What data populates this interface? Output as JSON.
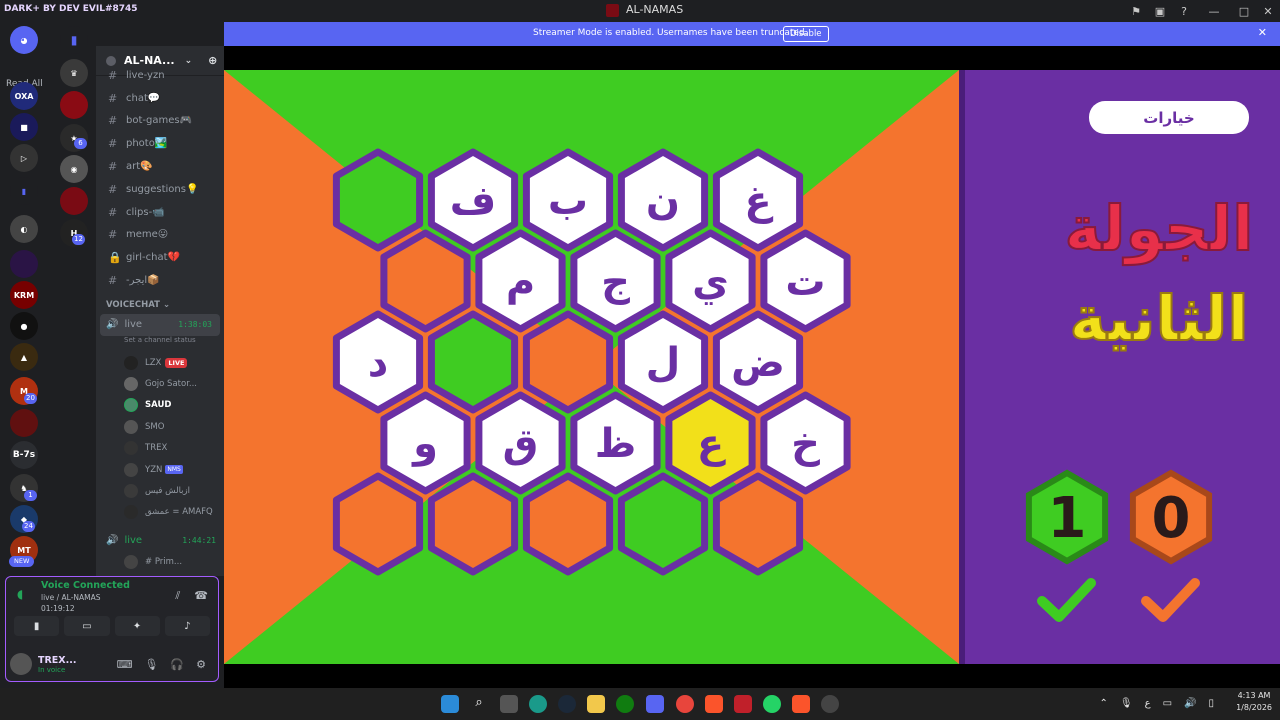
{
  "window": {
    "brand": "DARK+ BY DEV EVIL#8745",
    "title": "AL-NAMAS"
  },
  "servers": {
    "read_all": "Read All",
    "badges": [
      "6",
      "12",
      "20",
      "1",
      "24"
    ],
    "new": "NEW",
    "b7s": "B-7s"
  },
  "guild": {
    "name": "AL-NA..."
  },
  "channels": [
    {
      "name": "live-yzn"
    },
    {
      "name": "chat💬"
    },
    {
      "name": "bot-games🎮"
    },
    {
      "name": "photo🏞️"
    },
    {
      "name": "art🎨"
    },
    {
      "name": "suggestions💡"
    },
    {
      "name": "clips-📹"
    },
    {
      "name": "meme😛"
    },
    {
      "name": "girl-chat💔"
    },
    {
      "name": "-ايجر📦"
    }
  ],
  "voice_category": "VOICECHAT",
  "voice_channels": [
    {
      "name": "live",
      "timer": "1:38:03",
      "status_hint": "Set a channel status"
    },
    {
      "name": "live",
      "timer": "1:44:21"
    }
  ],
  "voice_users": [
    {
      "name": "LZX",
      "tag": "LIVE"
    },
    {
      "name": "Gojo Sator..."
    },
    {
      "name": "SAUD"
    },
    {
      "name": "SMO"
    },
    {
      "name": "TREX"
    },
    {
      "name": "YZN",
      "tag": "NMS"
    },
    {
      "name": "ازبالش فيس"
    },
    {
      "name": "عمشق = AMAFQ"
    }
  ],
  "second_vc_user": "# Prim...",
  "voice_panel": {
    "title": "Voice Connected",
    "channel": "live / AL-NAMAS",
    "time": "01:19:12"
  },
  "user_panel": {
    "name": "TREX...",
    "status": "In voice"
  },
  "banner": {
    "message": "Streamer Mode is enabled. Usernames have been truncated.",
    "button": "Disable"
  },
  "game": {
    "options_button": "خيارات",
    "round_line1": "الجولة",
    "round_line2": "الثانية",
    "score_green": "1",
    "score_orange": "0",
    "cells": [
      {
        "letter": "",
        "color": "green"
      },
      {
        "letter": "ف",
        "color": "white"
      },
      {
        "letter": "ب",
        "color": "white"
      },
      {
        "letter": "ن",
        "color": "white"
      },
      {
        "letter": "غ",
        "color": "white"
      },
      {
        "letter": "",
        "color": "orange"
      },
      {
        "letter": "م",
        "color": "white"
      },
      {
        "letter": "ج",
        "color": "white"
      },
      {
        "letter": "ي",
        "color": "white"
      },
      {
        "letter": "ت",
        "color": "white"
      },
      {
        "letter": "د",
        "color": "white"
      },
      {
        "letter": "",
        "color": "green"
      },
      {
        "letter": "",
        "color": "orange"
      },
      {
        "letter": "ل",
        "color": "white"
      },
      {
        "letter": "ض",
        "color": "white"
      },
      {
        "letter": "و",
        "color": "white"
      },
      {
        "letter": "ق",
        "color": "white"
      },
      {
        "letter": "ظ",
        "color": "white"
      },
      {
        "letter": "ع",
        "color": "yellow"
      },
      {
        "letter": "خ",
        "color": "white"
      },
      {
        "letter": "",
        "color": "orange"
      },
      {
        "letter": "",
        "color": "orange"
      },
      {
        "letter": "",
        "color": "orange"
      },
      {
        "letter": "",
        "color": "green"
      },
      {
        "letter": "",
        "color": "orange"
      }
    ]
  },
  "taskbar": {
    "time": "4:13 AM",
    "date": "1/8/2026",
    "lang": "ع"
  },
  "colors": {
    "green": "#3fcc22",
    "orange": "#f4742e",
    "purple": "#6a2fa3",
    "yellow": "#f2e01a",
    "white": "#ffffff",
    "blurple": "#5865f2"
  }
}
